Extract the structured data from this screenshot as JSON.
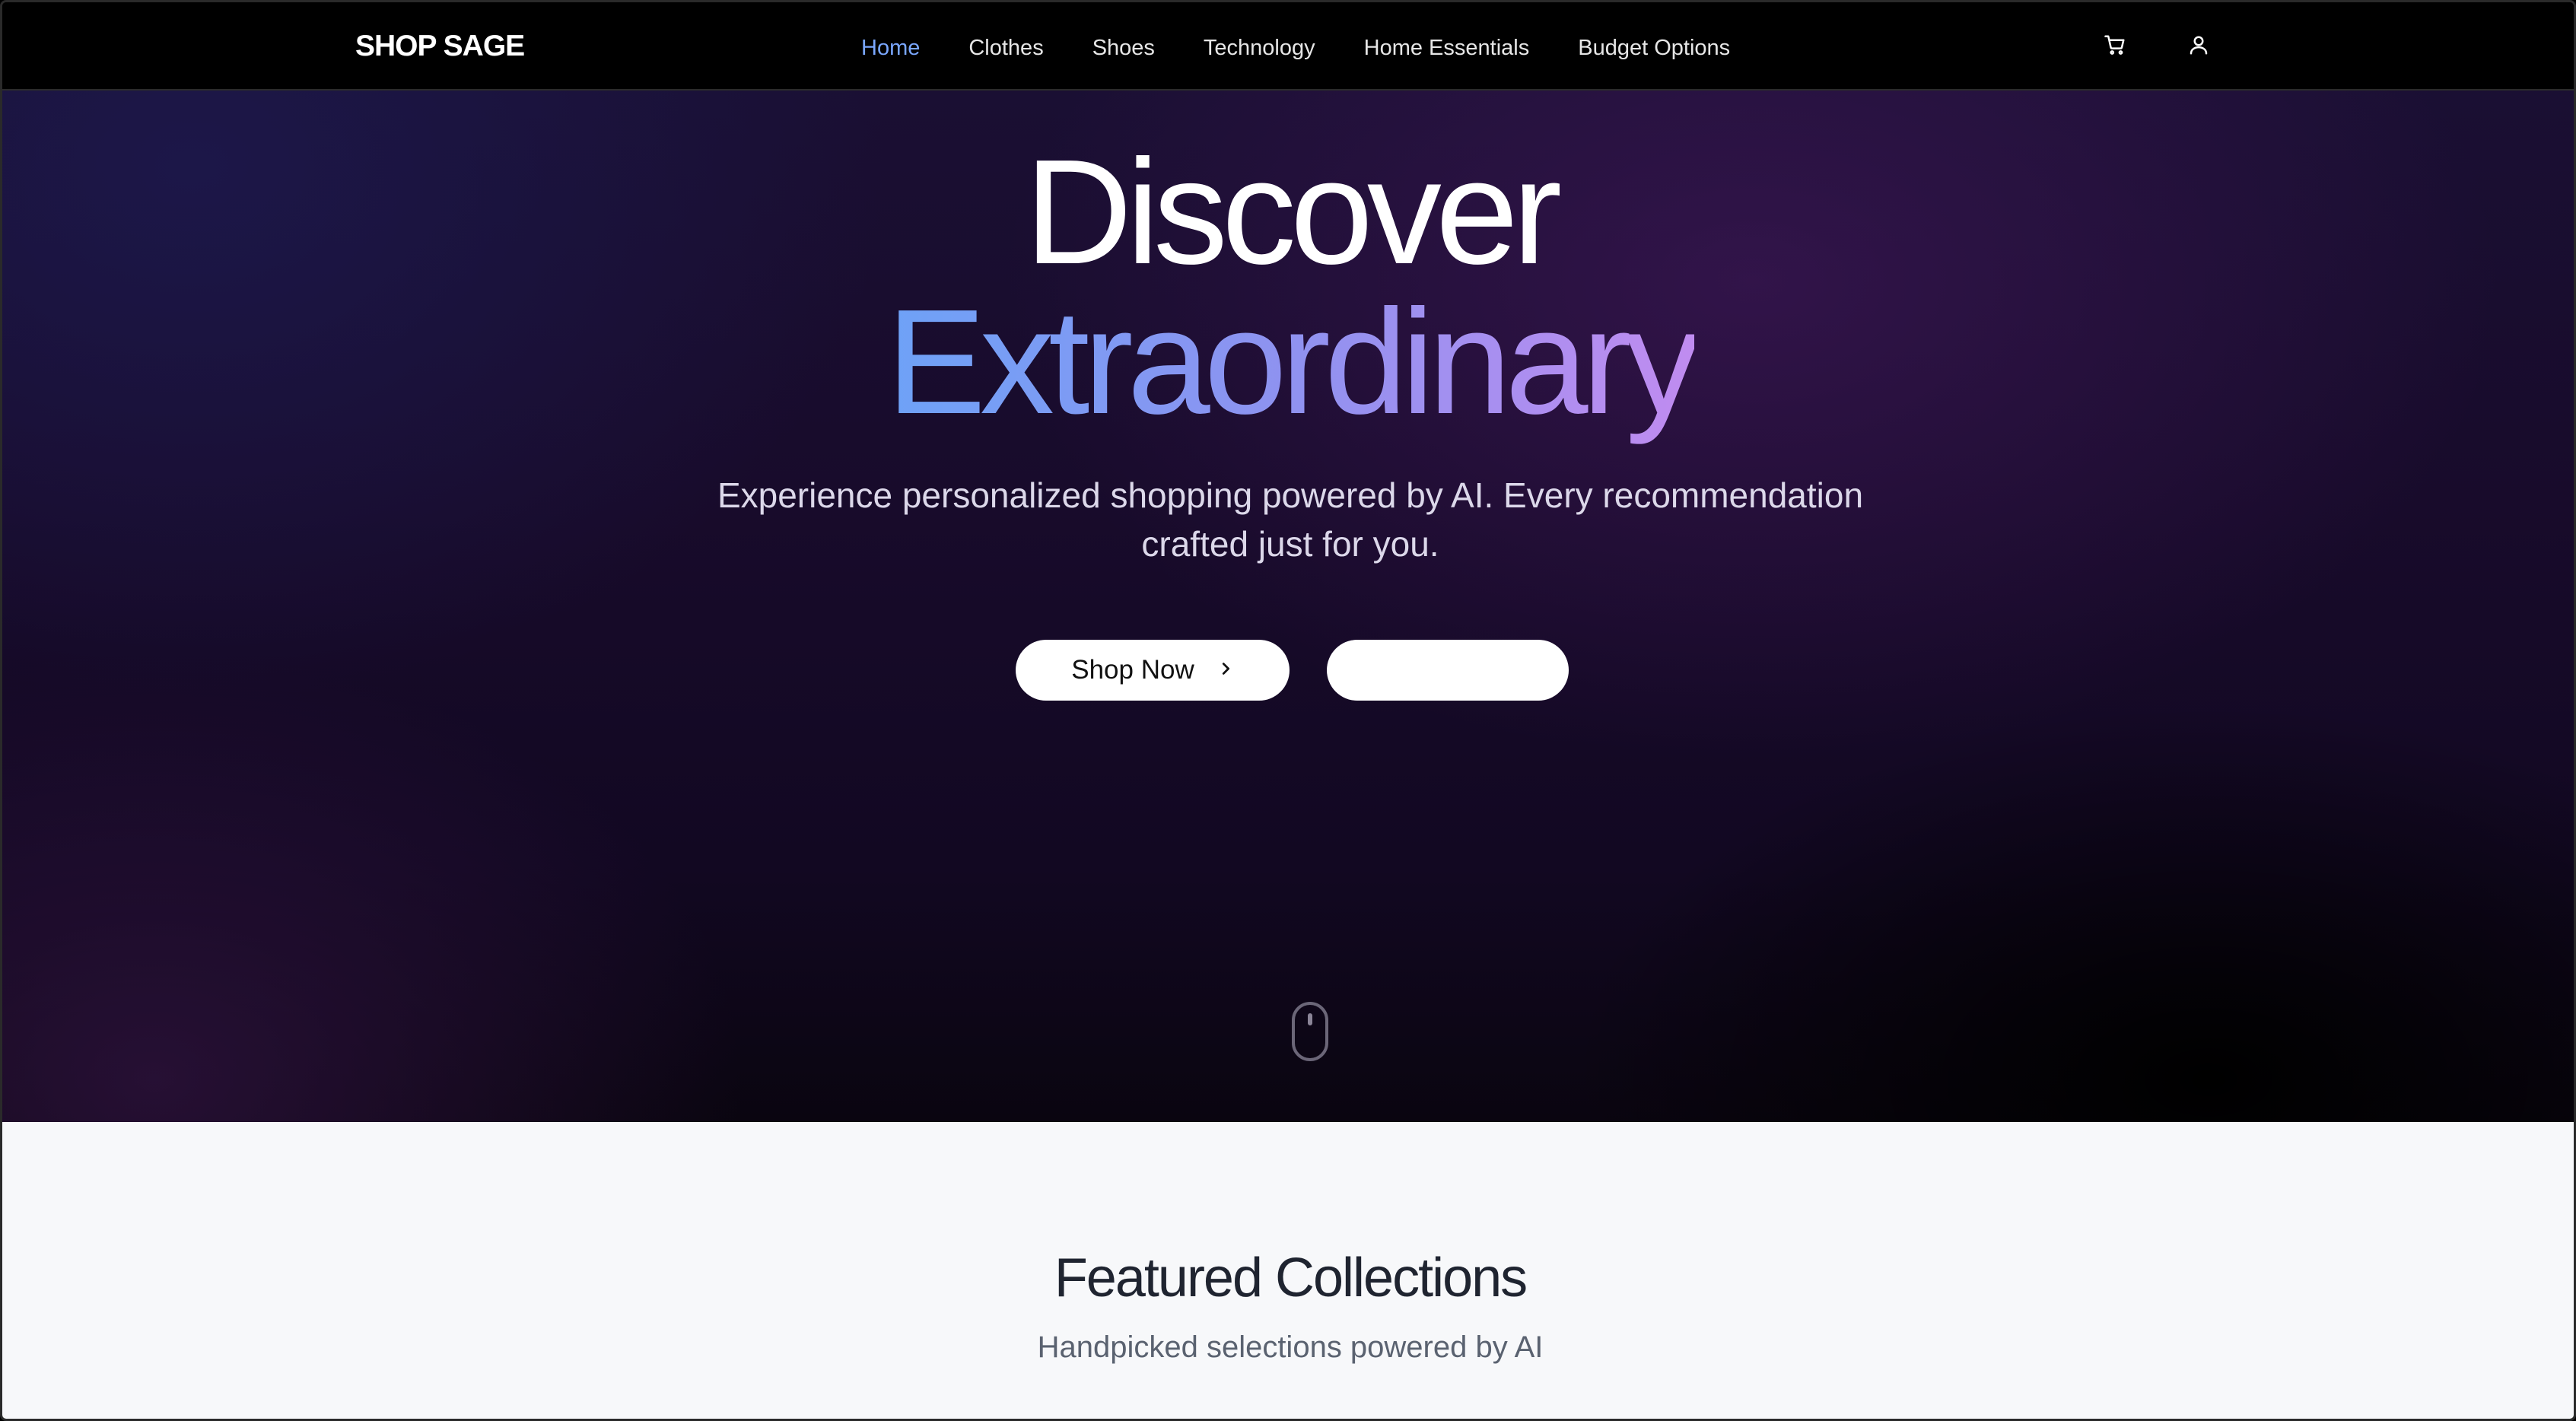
{
  "nav": {
    "logo": "SHOP SAGE",
    "links": [
      {
        "label": "Home",
        "active": true
      },
      {
        "label": "Clothes",
        "active": false
      },
      {
        "label": "Shoes",
        "active": false
      },
      {
        "label": "Technology",
        "active": false
      },
      {
        "label": "Home Essentials",
        "active": false
      },
      {
        "label": "Budget Options",
        "active": false
      }
    ],
    "icons": {
      "cart": "shopping-cart-icon",
      "user": "user-icon"
    },
    "active_color": "#7aa7ff"
  },
  "hero": {
    "title_line1": "Discover",
    "title_line2": "Extraordinary",
    "subtitle": "Experience personalized shopping powered by AI. Every recommendation crafted just for you.",
    "primary_button": "Shop Now",
    "primary_button_icon": "chevron-right-icon",
    "secondary_button": "",
    "scroll_icon": "mouse-scroll-icon",
    "gradient_colors": [
      "#6ea2f7",
      "#c08cf0"
    ]
  },
  "featured": {
    "title": "Featured Collections",
    "subtitle": "Handpicked selections powered by AI"
  }
}
